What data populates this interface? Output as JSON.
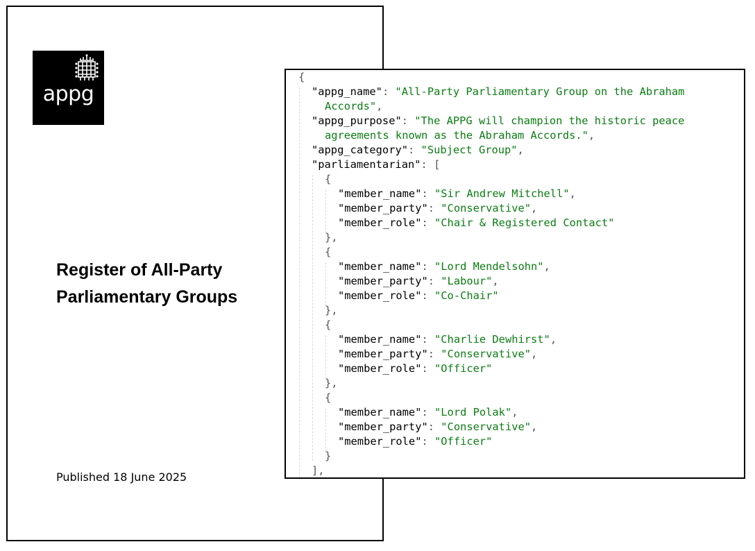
{
  "document": {
    "logo_text": "appg",
    "title_line1": "Register of All-Party",
    "title_line2": "Parliamentary Groups",
    "published": "Published 18 June 2025"
  },
  "json_view": {
    "open_brace": "{",
    "appg_name_key": "\"appg_name\"",
    "appg_name_value_1": "\"All-Party Parliamentary Group on the Abraham",
    "appg_name_value_2": "Accords\"",
    "appg_purpose_key": "\"appg_purpose\"",
    "appg_purpose_value_1": "\"The APPG will champion the historic peace",
    "appg_purpose_value_2": "agreements known as the Abraham Accords.\"",
    "appg_category_key": "\"appg_category\"",
    "appg_category_value": "\"Subject Group\"",
    "parliamentarian_key": "\"parliamentarian\"",
    "member_name_key": "\"member_name\"",
    "member_party_key": "\"member_party\"",
    "member_role_key": "\"member_role\"",
    "members": [
      {
        "name": "\"Sir Andrew Mitchell\"",
        "party": "\"Conservative\"",
        "role": "\"Chair & Registered Contact\""
      },
      {
        "name": "\"Lord Mendelsohn\"",
        "party": "\"Labour\"",
        "role": "\"Co-Chair\""
      },
      {
        "name": "\"Charlie Dewhirst\"",
        "party": "\"Conservative\"",
        "role": "\"Officer\""
      },
      {
        "name": "\"Lord Polak\"",
        "party": "\"Conservative\"",
        "role": "\"Officer\""
      }
    ]
  }
}
